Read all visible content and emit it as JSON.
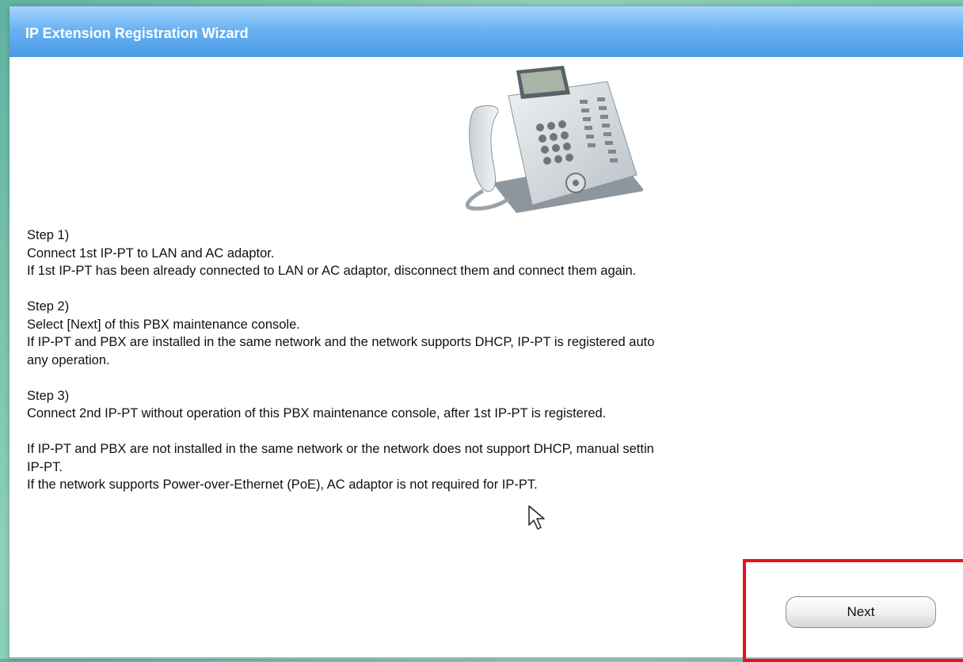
{
  "window": {
    "title": "IP Extension Registration Wizard"
  },
  "illustration": {
    "icon": "ip-phone-icon"
  },
  "steps": {
    "step1_title": "Step 1)",
    "step1_line1": "Connect 1st IP-PT to LAN and AC adaptor.",
    "step1_line2": "If 1st IP-PT has been already connected to LAN or AC adaptor, disconnect them and connect them again.",
    "step2_title": "Step 2)",
    "step2_line1": "Select [Next] of this PBX maintenance console.",
    "step2_line2": "If IP-PT and PBX are installed in the same network and the network supports DHCP, IP-PT is registered auto",
    "step2_line3": "any operation.",
    "step3_title": "Step 3)",
    "step3_line1": "Connect 2nd IP-PT without operation of this PBX maintenance console, after 1st IP-PT is registered."
  },
  "notes": {
    "line1": "If IP-PT and PBX are not installed in the same network or the network does not support DHCP, manual settin",
    "line2": "IP-PT.",
    "line3": "If the network supports Power-over-Ethernet (PoE), AC adaptor is not required for IP-PT."
  },
  "buttons": {
    "next_label": "Next"
  },
  "colors": {
    "titlebar": "#4a9ae6",
    "highlight": "#e8101a"
  }
}
